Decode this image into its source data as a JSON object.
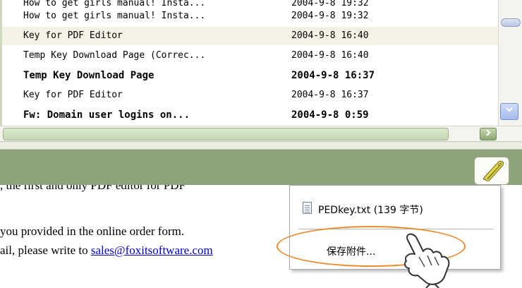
{
  "message_list": {
    "rows": [
      {
        "subject": "How to get girls manual! Insta...",
        "date": "2004-9-8 19:32",
        "bold": false,
        "selected": false
      },
      {
        "subject": "Key for PDF Editor",
        "date": "2004-9-8 16:40",
        "bold": false,
        "selected": true
      },
      {
        "subject": "Temp Key Download Page (Correc...",
        "date": "2004-9-8 16:40",
        "bold": false,
        "selected": false
      },
      {
        "subject": "Temp Key Download Page",
        "date": "2004-9-8 16:37",
        "bold": true,
        "selected": false
      },
      {
        "subject": "Key for PDF Editor",
        "date": "2004-9-8 16:37",
        "bold": false,
        "selected": false
      },
      {
        "subject": "Fw: Domain user logins on...",
        "date": "2004-9-8 0:59",
        "bold": true,
        "selected": false
      }
    ]
  },
  "preview": {
    "line1": ", the first and only PDF editor for PDF",
    "line2": "you provided in the online order form.",
    "line3_prefix": "ail, please write to ",
    "line3_link": "sales@foxitsoftware.com"
  },
  "attachment_menu": {
    "file_item": "PEDkey.txt (139 字节)",
    "save_item": "保存附件..."
  },
  "icons": {
    "attachment": "paperclip-icon",
    "file": "text-file-icon",
    "cursor": "hand-pointer-icon",
    "scroll_down": "chevron-down-icon",
    "scroll_right": "chevron-right-icon"
  },
  "colors": {
    "header_bar": "#8da47b",
    "highlight_ring": "#ef8a2b",
    "link": "#0000cc",
    "selected_row": "#f4f2e4"
  }
}
